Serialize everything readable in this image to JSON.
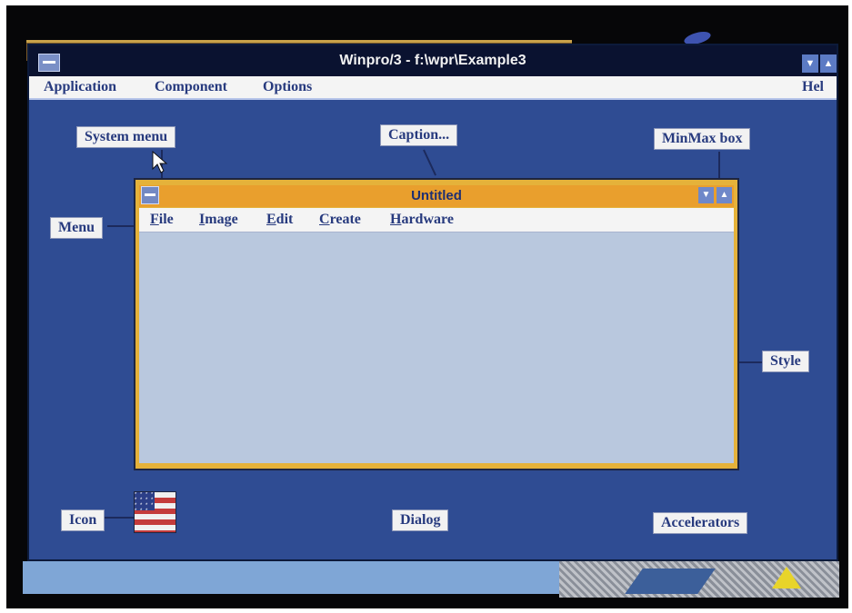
{
  "window": {
    "title": "Winpro/3 - f:\\wpr\\Example3",
    "menu": [
      "Application",
      "Component",
      "Options",
      "Hel"
    ],
    "minimize_glyph": "▼",
    "restore_glyph": "▲"
  },
  "labels": {
    "system_menu": "System menu",
    "caption": "Caption...",
    "minmax_box": "MinMax box",
    "menu": "Menu",
    "style": "Style",
    "icon": "Icon",
    "dialog": "Dialog",
    "accelerators": "Accelerators"
  },
  "child_window": {
    "title": "Untitled",
    "menu": [
      {
        "accel": "F",
        "rest": "ile"
      },
      {
        "accel": "I",
        "rest": "mage"
      },
      {
        "accel": "E",
        "rest": "dit"
      },
      {
        "accel": "C",
        "rest": "reate"
      },
      {
        "accel": "H",
        "rest": "ardware"
      }
    ],
    "min_glyph": "▼",
    "max_glyph": "▲"
  },
  "icons": {
    "system_menu_icon": "dash-box-icon",
    "flag_icon": "us-flag-icon",
    "cursor_icon": "arrow-cursor-icon"
  },
  "colors": {
    "desktop_blue": "#2f4c93",
    "caption_orange": "#e99f2d",
    "client_area": "#b9c8de",
    "label_text": "#273a7e"
  }
}
